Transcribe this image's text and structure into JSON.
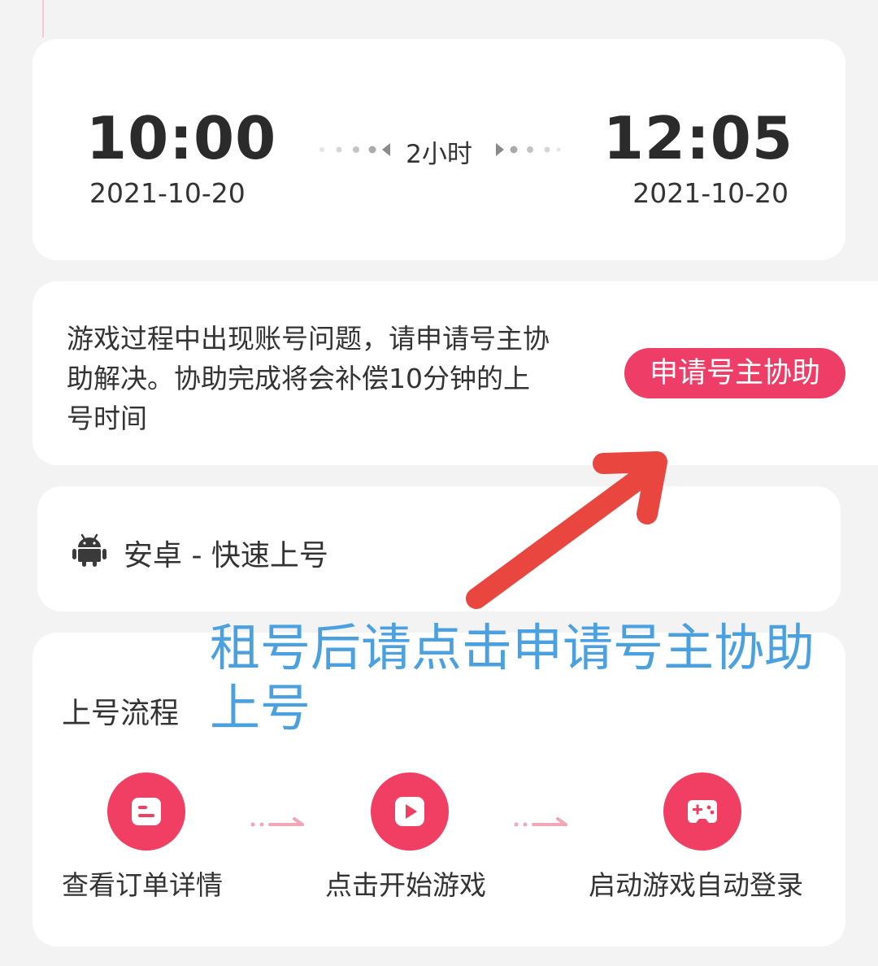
{
  "trip": {
    "start_time": "10:00",
    "start_date": "2021-10-20",
    "end_time": "12:05",
    "end_date": "2021-10-20",
    "duration": "2小时"
  },
  "assist": {
    "description": "游戏过程中出现账号问题，请申请号主协助解决。协助完成将会补偿10分钟的上号时间",
    "button_label": "申请号主协助"
  },
  "platform": {
    "label": "安卓 - 快速上号"
  },
  "process": {
    "title": "上号流程",
    "steps": [
      {
        "label": "查看订单详情",
        "icon": "order-icon"
      },
      {
        "label": "点击开始游戏",
        "icon": "play-icon"
      },
      {
        "label": "启动游戏自动登录",
        "icon": "gamepad-icon"
      }
    ]
  },
  "annotation": {
    "text": "租号后请点击申请号主协助上号"
  },
  "colors": {
    "accent": "#ee3d66",
    "annotation_blue": "#4ba0e0",
    "arrow_red": "#e8463f",
    "background": "#f3f3f3"
  }
}
